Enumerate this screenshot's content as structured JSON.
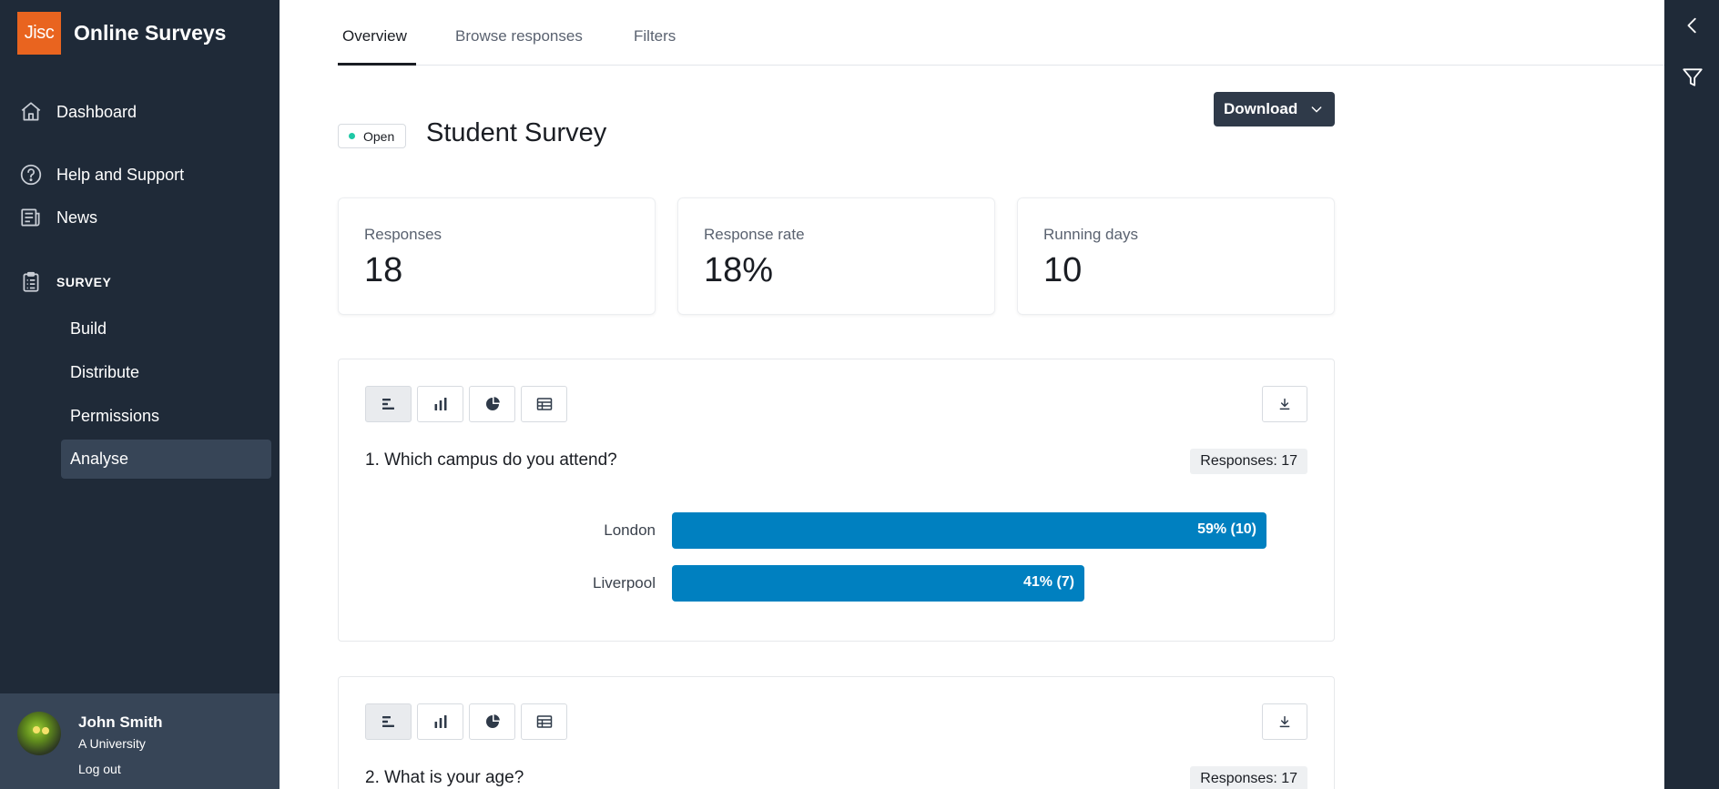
{
  "brand": {
    "logo_text": "Jisc",
    "title": "Online Surveys",
    "logo_color": "#e9641f"
  },
  "nav": {
    "dashboard": "Dashboard",
    "help": "Help and Support",
    "news": "News",
    "section": "SURVEY",
    "sub_items": [
      "Build",
      "Distribute",
      "Permissions",
      "Analyse"
    ],
    "active_sub": "Analyse"
  },
  "user": {
    "name": "John Smith",
    "org": "A University",
    "logout": "Log out"
  },
  "tabs": [
    "Overview",
    "Browse responses",
    "Filters"
  ],
  "active_tab": "Overview",
  "survey": {
    "status": "Open",
    "title": "Student Survey",
    "download_label": "Download"
  },
  "stats": [
    {
      "label": "Responses",
      "value": "18"
    },
    {
      "label": "Response rate",
      "value": "18%"
    },
    {
      "label": "Running days",
      "value": "10"
    }
  ],
  "questions": [
    {
      "title": "1. Which campus do you attend?",
      "responses": "Responses: 17",
      "chart_data": {
        "type": "bar",
        "orientation": "horizontal",
        "categories": [
          "London",
          "Liverpool"
        ],
        "values": [
          10,
          7
        ],
        "percents": [
          59,
          41
        ],
        "labels": [
          "59% (10)",
          "41% (7)"
        ],
        "color": "#0080c0"
      }
    },
    {
      "title": "2. What is your age?",
      "responses": "Responses: 17"
    }
  ],
  "icons": {
    "sidebar": [
      "home-icon",
      "help-circle-icon",
      "newspaper-icon",
      "clipboard-icon"
    ],
    "rail": [
      "chevron-left-icon",
      "filter-icon"
    ],
    "chart_toggles": [
      "horizontal-bar-icon",
      "vertical-bar-icon",
      "pie-chart-icon",
      "table-icon"
    ],
    "download": "download-icon"
  },
  "colors": {
    "sidebar": "#1f2a38",
    "status_dot": "#1ec8a5",
    "bar": "#0080c0"
  }
}
